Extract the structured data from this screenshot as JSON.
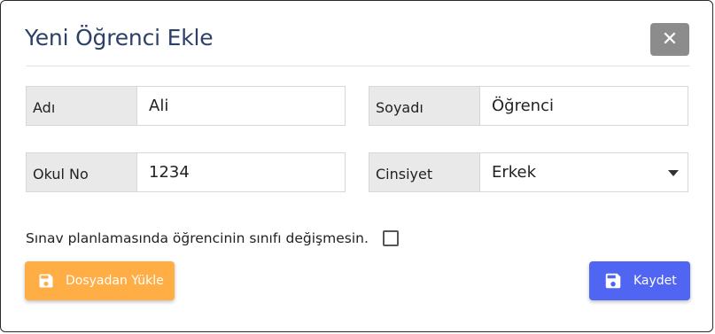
{
  "dialog": {
    "title": "Yeni Öğrenci Ekle",
    "close_icon": "close-icon",
    "close_symbol": "✕"
  },
  "form": {
    "first_name": {
      "label": "Adı",
      "value": "Ali"
    },
    "last_name": {
      "label": "Soyadı",
      "value": "Öğrenci"
    },
    "school_no": {
      "label": "Okul No",
      "value": "1234"
    },
    "gender": {
      "label": "Cinsiyet",
      "value": "Erkek"
    },
    "keep_class_checkbox": {
      "label": "Sınav planlamasında öğrencinin sınıfı değişmesin.",
      "checked": false
    }
  },
  "buttons": {
    "upload": {
      "label": "Dosyadan Yükle",
      "icon": "save-icon",
      "color": "#ffad45"
    },
    "save": {
      "label": "Kaydet",
      "icon": "save-icon",
      "color": "#5066f2"
    }
  },
  "colors": {
    "title": "#2c4169",
    "close_button": "#8c8c8c"
  }
}
